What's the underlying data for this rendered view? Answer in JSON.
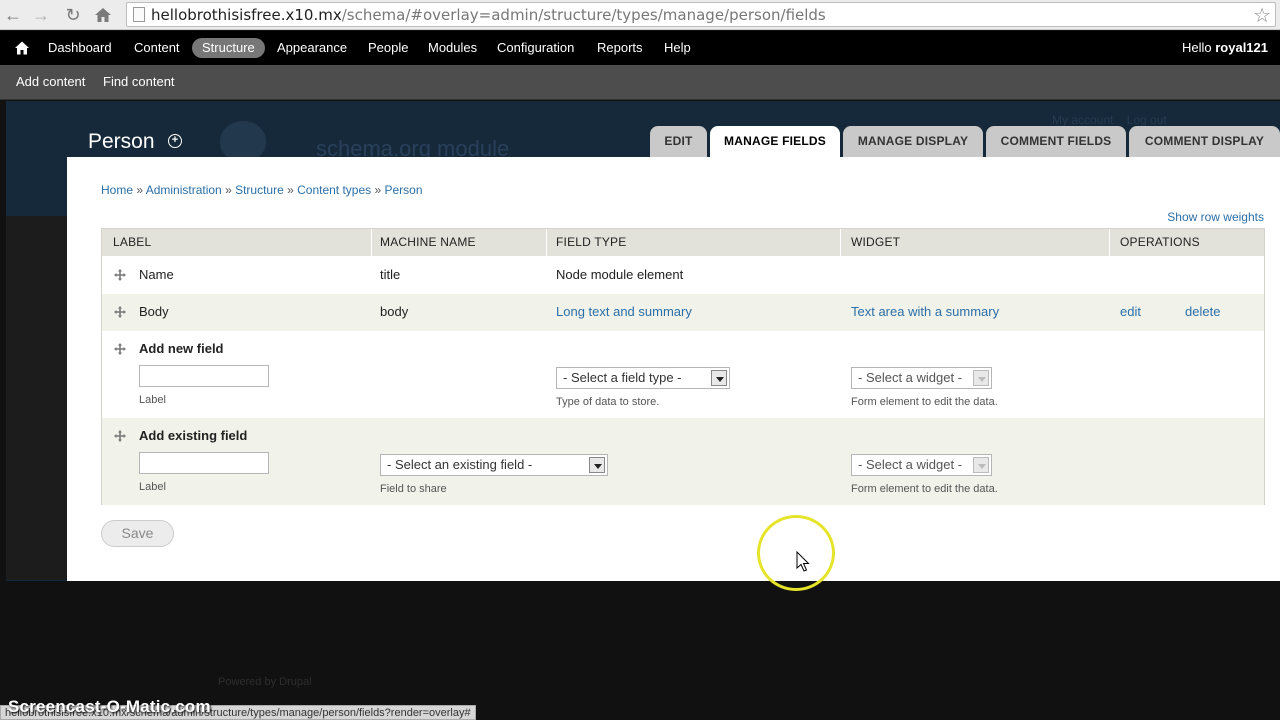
{
  "browser": {
    "url_host": "hellobrothisisfree.x10.mx",
    "url_path": "/schema/#overlay=admin/structure/types/manage/person/fields",
    "status_url": "hellobrothisisfree.x10.mx/schema/admin/structure/types/manage/person/fields?render=overlay#"
  },
  "toolbar": {
    "items": [
      "Dashboard",
      "Content",
      "Structure",
      "Appearance",
      "People",
      "Modules",
      "Configuration",
      "Reports",
      "Help"
    ],
    "active": "Structure",
    "hello": "Hello",
    "user": "royal121"
  },
  "shortcuts": [
    "Add content",
    "Find content"
  ],
  "background": {
    "brand": "schema.org module",
    "links": [
      "My account",
      "Log out"
    ],
    "powered": "Powered by Drupal"
  },
  "overlay": {
    "title": "Person",
    "tabs": [
      "EDIT",
      "MANAGE FIELDS",
      "MANAGE DISPLAY",
      "COMMENT FIELDS",
      "COMMENT DISPLAY"
    ],
    "active_tab": "MANAGE FIELDS",
    "breadcrumb": [
      "Home",
      "Administration",
      "Structure",
      "Content types",
      "Person"
    ],
    "show_row_weights": "Show row weights"
  },
  "table": {
    "headers": [
      "LABEL",
      "MACHINE NAME",
      "FIELD TYPE",
      "WIDGET",
      "OPERATIONS"
    ],
    "rows": [
      {
        "label": "Name",
        "machine": "title",
        "type": "Node module element",
        "widget": "",
        "ops": []
      },
      {
        "label": "Body",
        "machine": "body",
        "type": "Long text and summary",
        "widget": "Text area with a summary",
        "ops": [
          "edit",
          "delete"
        ]
      }
    ],
    "new_field": {
      "title": "Add new field",
      "label_desc": "Label",
      "type_select": "- Select a field type -",
      "type_desc": "Type of data to store.",
      "widget_select": "- Select a widget -",
      "widget_desc": "Form element to edit the data."
    },
    "existing_field": {
      "title": "Add existing field",
      "label_desc": "Label",
      "field_select": "- Select an existing field -",
      "field_desc": "Field to share",
      "widget_select": "- Select a widget -",
      "widget_desc": "Form element to edit the data."
    }
  },
  "save_label": "Save",
  "watermark": "Screencast-O-Matic.com",
  "colors": {
    "toolbar": "#000000",
    "shortcuts": "#4d4d4d",
    "link": "#2b6fa8",
    "row_alt": "#f1f2ea",
    "header": "#e2e2da",
    "cursor_ring": "#e6e42a"
  }
}
